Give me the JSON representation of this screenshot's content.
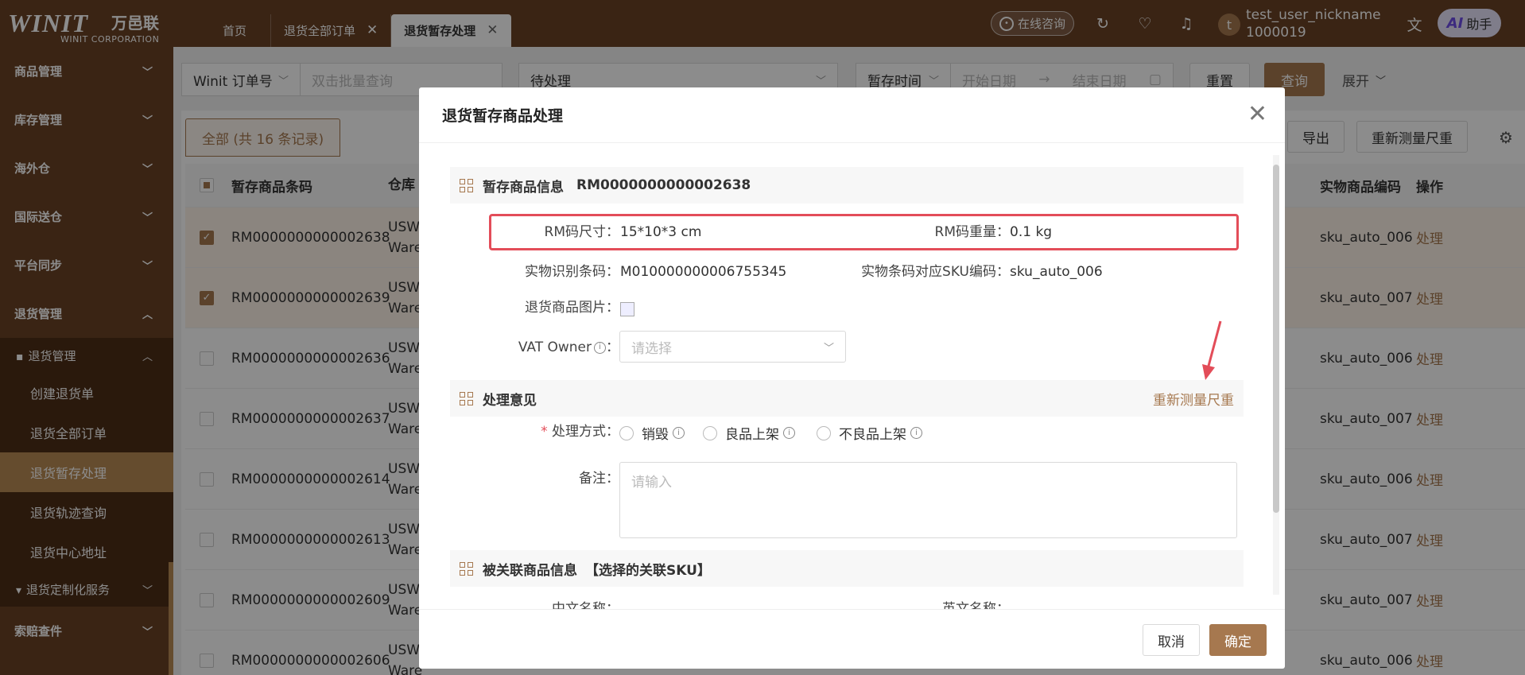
{
  "brand": {
    "mark": "WINIT",
    "cn": "万邑联",
    "en": "WINIT CORPORATION"
  },
  "tabs": [
    {
      "label": "首页",
      "closable": false,
      "active": false
    },
    {
      "label": "退货全部订单",
      "closable": true,
      "active": false
    },
    {
      "label": "退货暂存处理",
      "closable": true,
      "active": true
    }
  ],
  "header": {
    "consult_label": "在线咨询",
    "avatar_initial": "t",
    "user_name": "test_user_nickname",
    "user_id": "1000019",
    "ai_prefix": "AI",
    "ai_label": "助手",
    "icons": [
      "refresh-icon",
      "feedback-icon",
      "bell-icon",
      "translate-icon"
    ]
  },
  "sidebar": {
    "menus_top": [
      "商品管理",
      "库存管理",
      "海外仓",
      "国际送仓",
      "平台同步",
      "退货管理"
    ],
    "sub_group": "退货管理",
    "sub_items": [
      "创建退货单",
      "退货全部订单",
      "退货暂存处理",
      "退货轨迹查询",
      "退货中心地址"
    ],
    "active_sub": "退货暂存处理",
    "custom_group": "退货定制化服务",
    "menus_bottom": [
      "索赔查件"
    ]
  },
  "filters": {
    "type_select": "Winit 订单号",
    "batch_placeholder": "双击批量查询",
    "status_select": "待处理",
    "time_select": "暂存时间",
    "start_placeholder": "开始日期",
    "range_sep": "→",
    "end_placeholder": "结束日期",
    "reset": "重置",
    "query": "查询",
    "expand": "展开"
  },
  "list": {
    "all_tab": "全部 (共 16 条记录)",
    "export": "导出",
    "remeasure": "重新测量尺重",
    "columns": {
      "code": "暂存商品条码",
      "warehouse": "仓库",
      "sku": "实物商品编码",
      "op": "操作"
    },
    "rows": [
      {
        "checked": true,
        "code": "RM0000000000002638",
        "wh1": "USW",
        "wh2": "Ware",
        "sku": "sku_auto_006",
        "op": "处理"
      },
      {
        "checked": true,
        "code": "RM0000000000002639",
        "wh1": "USW",
        "wh2": "Ware",
        "sku": "sku_auto_007",
        "op": "处理"
      },
      {
        "checked": false,
        "code": "RM0000000000002636",
        "wh1": "USW",
        "wh2": "Ware",
        "sku": "sku_auto_006",
        "op": "处理"
      },
      {
        "checked": false,
        "code": "RM0000000000002637",
        "wh1": "USW",
        "wh2": "Ware",
        "sku": "sku_auto_007",
        "op": "处理"
      },
      {
        "checked": false,
        "code": "RM0000000000002614",
        "wh1": "USW",
        "wh2": "Ware",
        "sku": "sku_auto_006",
        "op": "处理"
      },
      {
        "checked": false,
        "code": "RM0000000000002613",
        "wh1": "USW",
        "wh2": "Ware",
        "sku": "sku_auto_007",
        "op": "处理"
      },
      {
        "checked": false,
        "code": "RM0000000000002609",
        "wh1": "USW",
        "wh2": "Ware",
        "sku": "sku_auto_007",
        "op": "处理"
      },
      {
        "checked": false,
        "code": "RM0000000000002606",
        "wh1": "USW",
        "wh2": "Ware",
        "sku": "sku_auto_006",
        "op": "处理"
      }
    ]
  },
  "modal": {
    "title": "退货暂存商品处理",
    "sec_info": {
      "title": "暂存商品信息",
      "code": "RM0000000000002638"
    },
    "rm_size_label": "RM码尺寸：",
    "rm_size": "15*10*3 cm",
    "rm_weight_label": "RM码重量：",
    "rm_weight": "0.1 kg",
    "barcode_label": "实物识别条码：",
    "barcode": "M010000000006755345",
    "sku_label": "实物条码对应SKU编码：",
    "sku": "sku_auto_006",
    "image_label": "退货商品图片：",
    "vat_label": "VAT Owner",
    "vat_colon": "：",
    "vat_placeholder": "请选择",
    "sec_opinion": {
      "title": "处理意见",
      "link": "重新测量尺重"
    },
    "method_required": "*",
    "method_label": "处理方式：",
    "methods": [
      "销毁",
      "良品上架",
      "不良品上架"
    ],
    "remark_label": "备注：",
    "remark_placeholder": "请输入",
    "sec_linked": {
      "title": "被关联商品信息",
      "hint": "【选择的关联SKU】"
    },
    "cn_name_label": "中文名称：",
    "en_name_label": "英文名称：",
    "cancel": "取消",
    "confirm": "确定"
  },
  "colors": {
    "brand": "#6b4225",
    "accent": "#a6784f",
    "highlight": "#e34d59"
  }
}
